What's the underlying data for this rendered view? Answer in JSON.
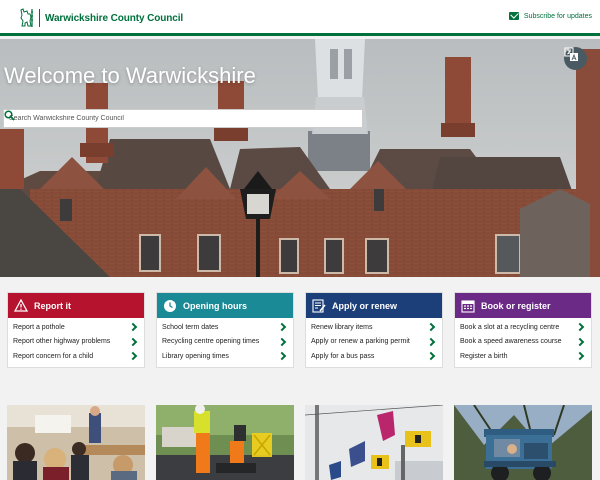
{
  "header": {
    "council_name": "Warwickshire County Council",
    "subscribe_label": "Subscribe for updates",
    "logo_icon": "bear-and-ragged-staff-logo",
    "brand_color": "#00703c"
  },
  "hero": {
    "title": "Welcome to Warwickshire",
    "search_placeholder": "Search Warwickshire County Council",
    "search_icon": "search-icon",
    "translate_icon": "translate-icon"
  },
  "cards": [
    {
      "title": "Report it",
      "color": "#b5132e",
      "icon": "warning-icon",
      "items": [
        "Report a pothole",
        "Report other highway problems",
        "Report concern for a child"
      ]
    },
    {
      "title": "Opening hours",
      "color": "#1a8a97",
      "icon": "clock-icon",
      "items": [
        "School term dates",
        "Recycling centre opening times",
        "Library opening times"
      ]
    },
    {
      "title": "Apply or renew",
      "color": "#1c3f7a",
      "icon": "form-icon",
      "items": [
        "Renew library items",
        "Apply or renew a parking permit",
        "Apply for a bus pass"
      ]
    },
    {
      "title": "Book or register",
      "color": "#6b2a86",
      "icon": "calendar-icon",
      "items": [
        "Book a slot at a recycling centre",
        "Book a speed awareness course",
        "Register a birth"
      ]
    }
  ],
  "photos": [
    "classroom-photo",
    "roadworks-photo",
    "road-signs-photo",
    "utility-vehicle-photo"
  ]
}
